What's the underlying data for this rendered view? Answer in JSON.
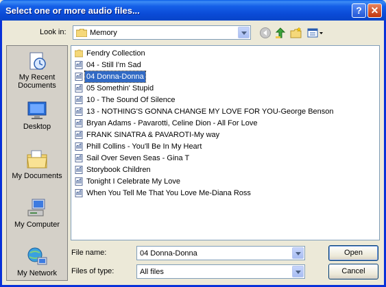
{
  "window": {
    "title": "Select one or more audio files..."
  },
  "titlebar_buttons": {
    "help": "?",
    "close": "✕"
  },
  "lookin": {
    "label": "Look in:",
    "value": "Memory"
  },
  "toolbar": {
    "back_icon": "back-icon",
    "up_icon": "up-folder-icon",
    "new_folder_icon": "new-folder-icon",
    "views_icon": "views-menu-icon"
  },
  "places": [
    {
      "label": "My Recent Documents",
      "icon": "recent-documents-icon"
    },
    {
      "label": "Desktop",
      "icon": "desktop-icon"
    },
    {
      "label": "My Documents",
      "icon": "my-documents-icon"
    },
    {
      "label": "My Computer",
      "icon": "my-computer-icon"
    },
    {
      "label": "My Network",
      "icon": "my-network-icon"
    }
  ],
  "files": [
    {
      "name": "Fendry Collection",
      "type": "folder"
    },
    {
      "name": "04 - Still I'm Sad",
      "type": "audio"
    },
    {
      "name": "04 Donna-Donna",
      "type": "audio",
      "selected": true
    },
    {
      "name": "05 Somethin' Stupid",
      "type": "audio"
    },
    {
      "name": "10 - The Sound Of Silence",
      "type": "audio"
    },
    {
      "name": "13 - NOTHING'S GONNA CHANGE MY LOVE FOR YOU-George Benson",
      "type": "audio"
    },
    {
      "name": "Bryan Adams - Pavarotti, Celine Dion - All For Love",
      "type": "audio"
    },
    {
      "name": "FRANK SINATRA & PAVAROTI-My way",
      "type": "audio"
    },
    {
      "name": "Phill Collins - You'll Be In My Heart",
      "type": "audio"
    },
    {
      "name": "Sail Over Seven Seas - Gina T",
      "type": "audio"
    },
    {
      "name": "Storybook Children",
      "type": "audio"
    },
    {
      "name": "Tonight I Celebrate My Love",
      "type": "audio"
    },
    {
      "name": "When You Tell Me That You Love Me-Diana Ross",
      "type": "audio"
    }
  ],
  "filename": {
    "label": "File name:",
    "value": "04 Donna-Donna"
  },
  "filetype": {
    "label": "Files of type:",
    "value": "All files"
  },
  "buttons": {
    "open": "Open",
    "cancel": "Cancel"
  },
  "colors": {
    "selection": "#316ac5",
    "titlebar": "#0a4ad6",
    "dialog_bg": "#ece9d8"
  }
}
